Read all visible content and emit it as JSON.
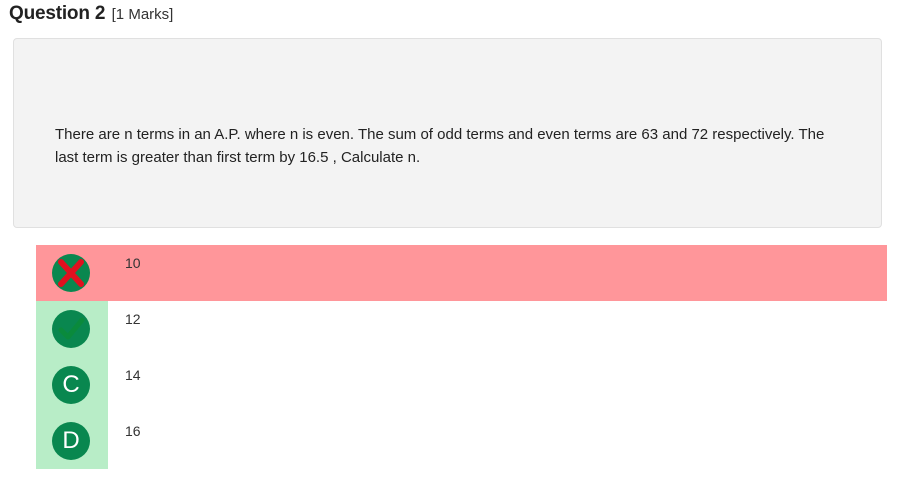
{
  "question": {
    "title": "Question 2",
    "marks": "[1 Marks]",
    "text": "There are n terms in an A.P. where n is even. The sum of odd terms and even terms are 63 and 72 respectively. The last term is greater than first term by 16.5 , Calculate n."
  },
  "options": [
    {
      "label": "10",
      "marker": "x-mark-icon",
      "state": "wrong"
    },
    {
      "label": "12",
      "marker": "check-mark-icon",
      "state": "correct"
    },
    {
      "label": "14",
      "marker": "C",
      "state": "normal"
    },
    {
      "label": "16",
      "marker": "D",
      "state": "normal"
    }
  ],
  "colors": {
    "wrong_bg": "#ff969a",
    "correct_bg": "#b8edc7",
    "badge": "#09874f",
    "x_mark": "#e0101f",
    "check_mark": "#0a8a3c",
    "question_box_bg": "#f3f3f3"
  }
}
